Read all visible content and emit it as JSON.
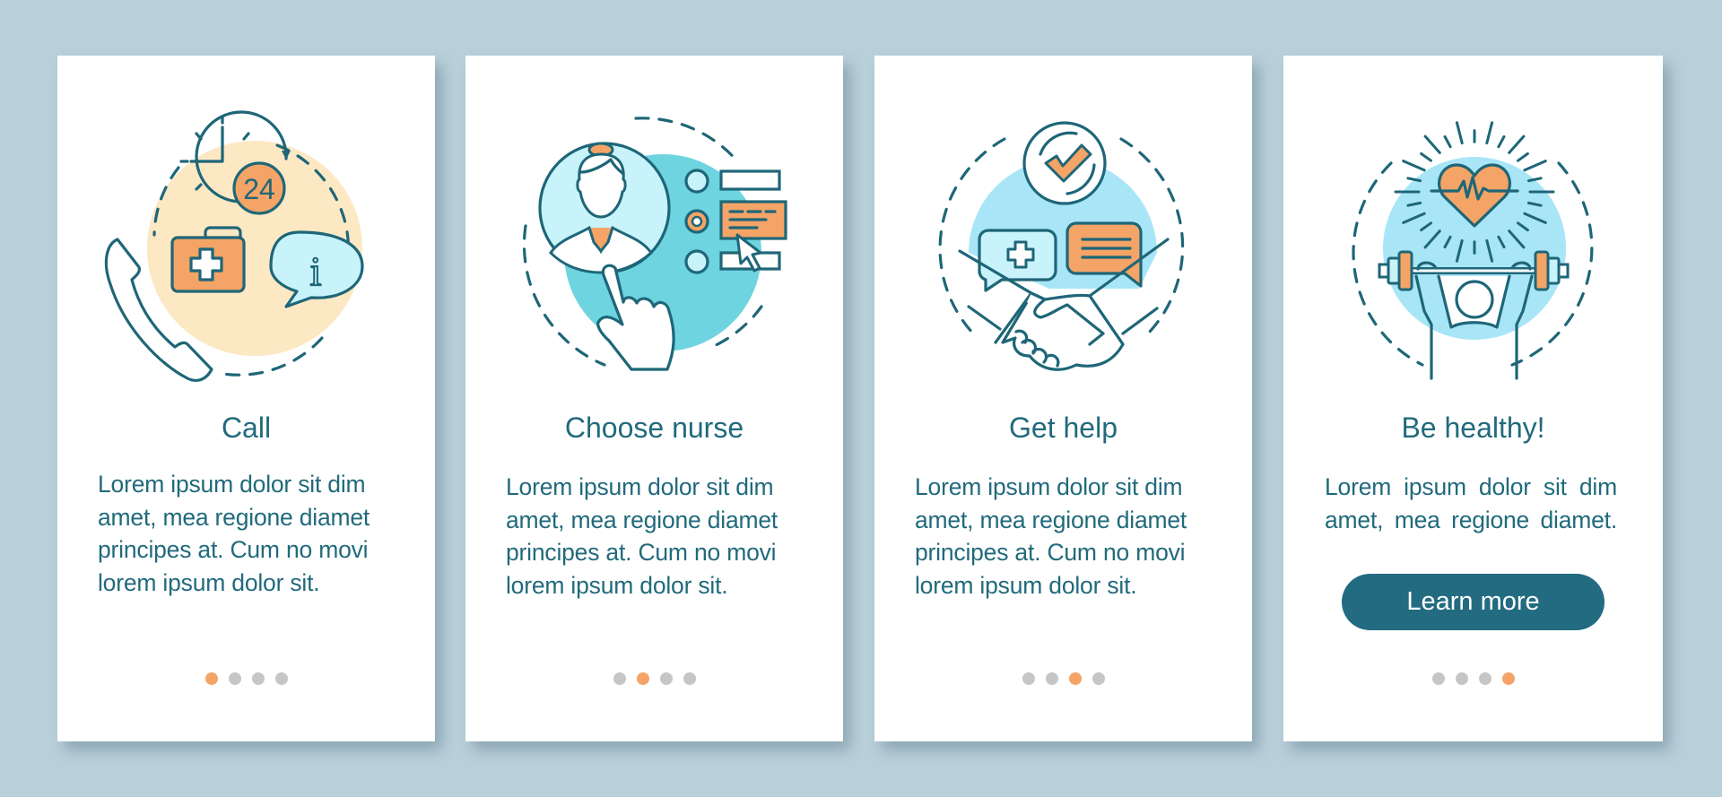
{
  "colors": {
    "background": "#b9d0da",
    "card": "#ffffff",
    "text": "#216a7c",
    "accent_orange": "#f4a466",
    "dot_inactive": "#c6c6c6",
    "button": "#226b80",
    "illus_stroke": "#1e6678",
    "illus_cream": "#fde8c4",
    "illus_teal": "#6dd4e0",
    "illus_lightblue": "#a8e6f7"
  },
  "cards": [
    {
      "title": "Call",
      "icon": "call-24-medical-kit-info-icon",
      "lines": [
        "Lorem ipsum dolor sit dim",
        "amet, mea regione diamet",
        "principes at. Cum no movi",
        "lorem ipsum dolor sit."
      ],
      "badge_text": "24",
      "info_glyph": "i",
      "active_page": 1
    },
    {
      "title": "Choose nurse",
      "icon": "choose-nurse-icon",
      "lines": [
        "Lorem ipsum dolor sit dim",
        "amet, mea regione diamet",
        "principes at. Cum no movi",
        "lorem ipsum dolor sit."
      ],
      "active_page": 2
    },
    {
      "title": "Get help",
      "icon": "handshake-help-icon",
      "lines": [
        "Lorem ipsum dolor sit dim",
        "amet, mea regione diamet",
        "principes at. Cum no movi",
        "lorem ipsum dolor sit."
      ],
      "active_page": 3
    },
    {
      "title": "Be healthy!",
      "icon": "healthy-heart-weightlifting-icon",
      "lines": [
        "Lorem ipsum dolor sit dim",
        "amet, mea regione diamet."
      ],
      "button_label": "Learn more",
      "active_page": 4
    }
  ],
  "pagination": {
    "total_pages": 4
  }
}
